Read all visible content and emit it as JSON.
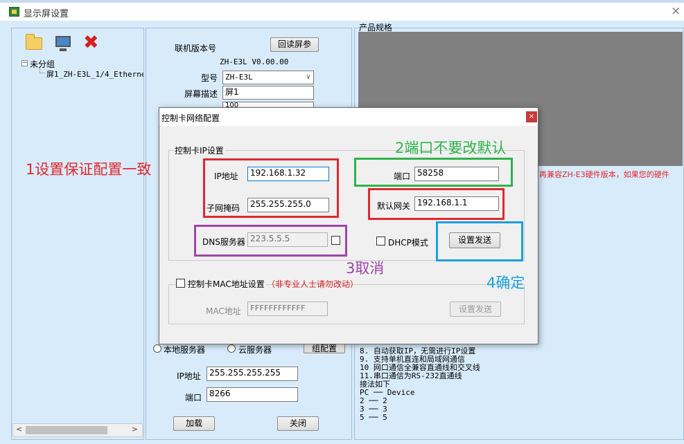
{
  "window": {
    "title": "显示屏设置",
    "close_glyph": "×"
  },
  "toolbar": {
    "folder_icon": "folder-icon",
    "monitor_icon": "monitor-icon",
    "delete_icon": "delete-icon",
    "delete_glyph": "✖"
  },
  "tree": {
    "expander": "−",
    "group": "未分组",
    "item": "屏1_ZH-E3L_1/4_Ethernet"
  },
  "scrollbar": {
    "left_arrow": "<",
    "right_arrow": ">"
  },
  "form": {
    "version_label": "联机版本号",
    "readback_button": "回读屏参",
    "version_value": "ZH-E3L V0.00.00",
    "model_label": "型号",
    "model_value": "ZH-E3L",
    "desc_label": "屏幕描述",
    "desc_value": "屏1",
    "hidden_value": "100",
    "radio_local": "本地服务器",
    "radio_cloud": "云服务器",
    "network_button": "组配置",
    "ip_label": "IP地址",
    "ip_value": "255.255.255.255",
    "port_label": "端口",
    "port_value": "8266",
    "load_button": "加载",
    "close_button": "关闭"
  },
  "spec": {
    "title": "产品规格",
    "compat_note": "再兼容ZH-E3硬件版本，如果您的硬件",
    "lines": [
      "8. 自动获取IP，无需进行IP设置",
      "9. 支持单机直连和局域网通信",
      "10 网口通信全兼容直通线和交叉线",
      "11.串口通信为RS-232直通线",
      "  接法如下",
      "     PC ── Device",
      "      2 ── 2",
      "      3 ── 3",
      "      5 ── 5"
    ]
  },
  "dialog": {
    "title": "控制卡网络配置",
    "close_glyph": "×",
    "ip_group": "控制卡IP设置",
    "ip_label": "IP地址",
    "ip_value": "192.168.1.32",
    "mask_label": "子网掩码",
    "mask_value": "255.255.255.0",
    "dns_label": "DNS服务器",
    "dns_value": "223.5.5.5",
    "port_label": "端口",
    "port_value": "58258",
    "gateway_label": "默认网关",
    "gateway_value": "192.168.1.1",
    "dhcp_label": "DHCP模式",
    "send_button": "设置发送",
    "mac_group_label": "控制卡MAC地址设置",
    "mac_warning": "（非专业人士请勿改动）",
    "mac_label": "MAC地址",
    "mac_value": "FFFFFFFFFFFF",
    "mac_send_button": "设置发送"
  },
  "annotations": {
    "a1": "1设置保证配置一致",
    "a2": "2端口不要改默认",
    "a3": "3取消",
    "a4": "4确定"
  },
  "colors": {
    "red": "#e0282e",
    "green": "#2db34a",
    "purple": "#9d46a8",
    "blue": "#1aa0dc",
    "bg": "#d8ebfa"
  }
}
